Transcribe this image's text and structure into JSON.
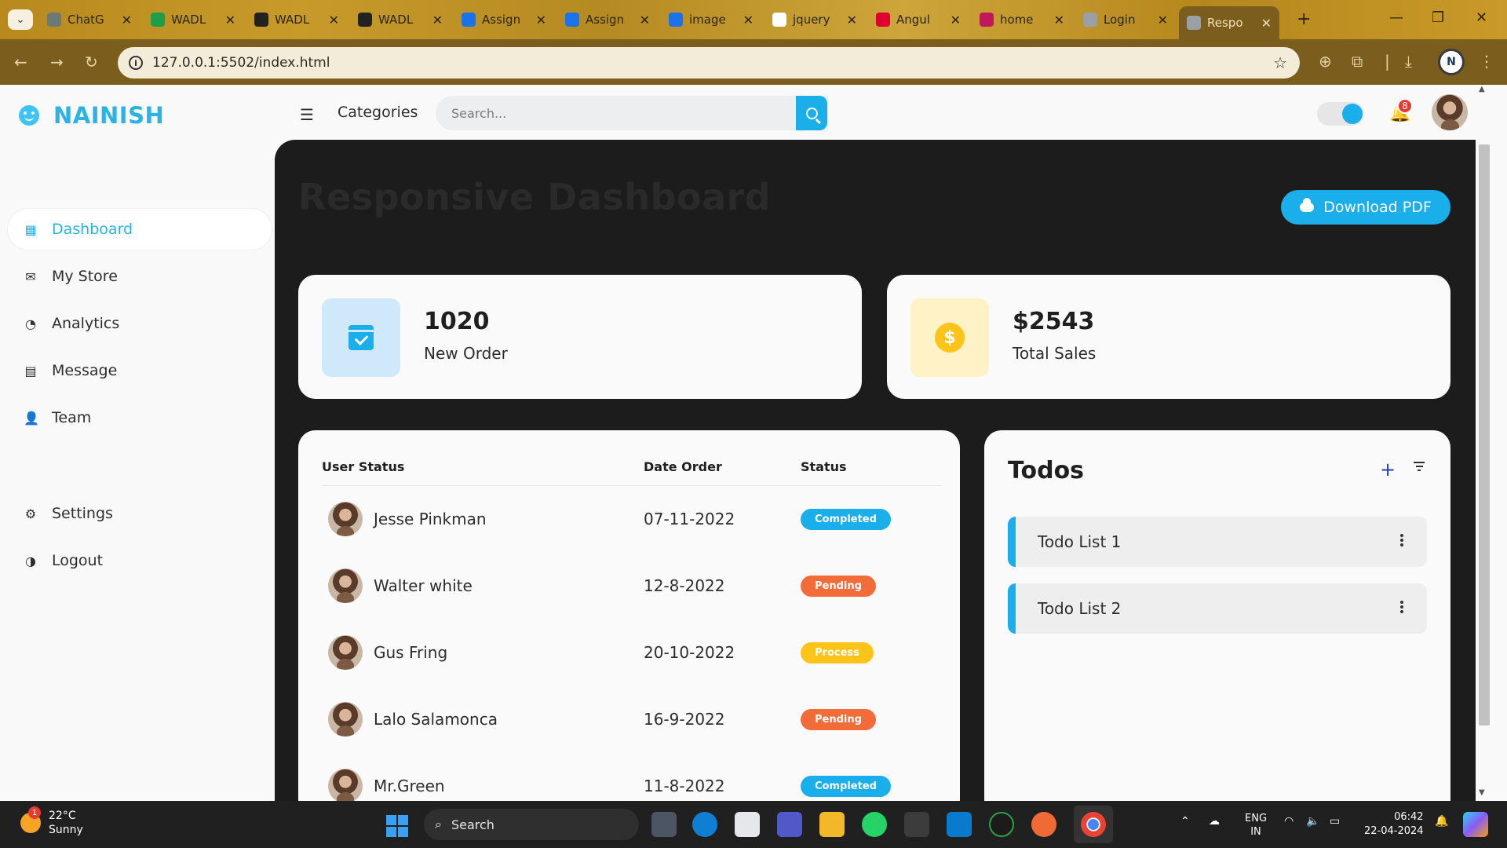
{
  "browser": {
    "tabs": [
      {
        "title": "ChatG",
        "favicon_color": "#6b7a74"
      },
      {
        "title": "WADL",
        "favicon_color": "#1e9e4a"
      },
      {
        "title": "WADL",
        "favicon_color": "#222222"
      },
      {
        "title": "WADL",
        "favicon_color": "#222222"
      },
      {
        "title": "Assign",
        "favicon_color": "#1a73e8"
      },
      {
        "title": "Assign",
        "favicon_color": "#1a73e8"
      },
      {
        "title": "image",
        "favicon_color": "#1a73e8"
      },
      {
        "title": "jquery",
        "favicon_color": "#ffffff"
      },
      {
        "title": "Angul",
        "favicon_color": "#dd0031"
      },
      {
        "title": "home",
        "favicon_color": "#c2185b"
      },
      {
        "title": "Login",
        "favicon_color": "#9aa0a6"
      },
      {
        "title": "Respo",
        "favicon_color": "#9aa0a6",
        "active": true
      }
    ],
    "url": "127.0.0.1:5502/index.html",
    "profile_initial": "N"
  },
  "sidebar": {
    "brand": "NAINISH",
    "items": [
      {
        "label": "Dashboard",
        "icon": "grid-icon",
        "active": true
      },
      {
        "label": "My Store",
        "icon": "store-icon"
      },
      {
        "label": "Analytics",
        "icon": "analytics-icon"
      },
      {
        "label": "Message",
        "icon": "message-icon"
      },
      {
        "label": "Team",
        "icon": "team-icon"
      }
    ],
    "bottom": [
      {
        "label": "Settings",
        "icon": "gear-icon"
      },
      {
        "label": "Logout",
        "icon": "logout-icon"
      }
    ]
  },
  "topnav": {
    "categories_label": "Categories",
    "search_placeholder": "Search...",
    "notification_count": "8",
    "theme_toggle": "on"
  },
  "main": {
    "title": "Responsive Dashboard",
    "download_label": "Download PDF",
    "stats": [
      {
        "value": "1020",
        "label": "New Order",
        "icon": "calendar-check-icon",
        "icon_bg": "#cfe9fb"
      },
      {
        "value": "$2543",
        "label": "Total Sales",
        "icon": "dollar-coin-icon",
        "icon_bg": "#fff2c7"
      }
    ],
    "orders": {
      "columns": [
        "User Status",
        "Date Order",
        "Status"
      ],
      "rows": [
        {
          "name": "Jesse Pinkman",
          "date": "07-11-2022",
          "status": "Completed",
          "status_color": "#1aaeea"
        },
        {
          "name": "Walter white",
          "date": "12-8-2022",
          "status": "Pending",
          "status_color": "#f26c3a"
        },
        {
          "name": "Gus Fring",
          "date": "20-10-2022",
          "status": "Process",
          "status_color": "#fcc419"
        },
        {
          "name": "Lalo Salamonca",
          "date": "16-9-2022",
          "status": "Pending",
          "status_color": "#f26c3a"
        },
        {
          "name": "Mr.Green",
          "date": "11-8-2022",
          "status": "Completed",
          "status_color": "#1aaeea"
        }
      ]
    },
    "todos": {
      "title": "Todos",
      "items": [
        {
          "label": "Todo List 1"
        },
        {
          "label": "Todo List 2"
        }
      ]
    }
  },
  "taskbar": {
    "weather_temp": "22°C",
    "weather_desc": "Sunny",
    "weather_badge": "1",
    "search_label": "Search",
    "lang_line1": "ENG",
    "lang_line2": "IN",
    "time": "06:42",
    "date": "22-04-2024"
  },
  "colors": {
    "accent": "#1aaeea",
    "brand": "#2bb3e6",
    "dark_panel": "#1c1c1c"
  }
}
